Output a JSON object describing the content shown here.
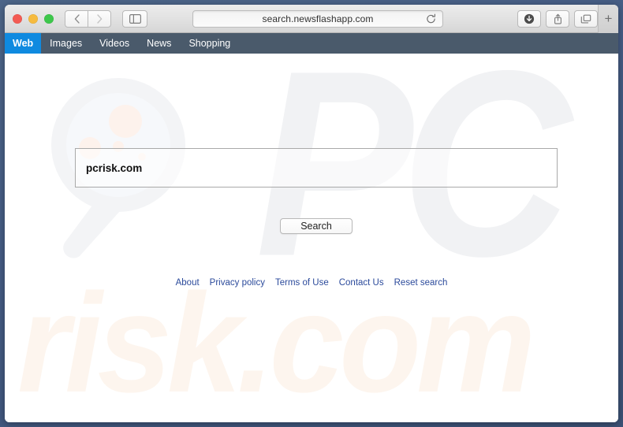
{
  "browser": {
    "traffic_lights": [
      "close",
      "minimize",
      "zoom"
    ],
    "back_label": "‹",
    "forward_label": "›",
    "sidebar_label": "sidebar",
    "url": "search.newsflashapp.com",
    "reload_label": "reload",
    "download_label": "download",
    "share_label": "share",
    "tabs_label": "show-tabs",
    "new_tab_label": "+"
  },
  "site_nav": {
    "items": [
      {
        "label": "Web",
        "active": true
      },
      {
        "label": "Images",
        "active": false
      },
      {
        "label": "Videos",
        "active": false
      },
      {
        "label": "News",
        "active": false
      },
      {
        "label": "Shopping",
        "active": false
      }
    ]
  },
  "search": {
    "query": "pcrisk.com",
    "placeholder": "",
    "button_label": "Search"
  },
  "watermarks": {
    "top": "PC",
    "bottom": "risk.com",
    "magnifier": "magnifying-glass"
  },
  "footer": {
    "links": [
      {
        "label": "About"
      },
      {
        "label": "Privacy policy"
      },
      {
        "label": "Terms of Use"
      },
      {
        "label": "Contact Us"
      },
      {
        "label": "Reset search"
      }
    ]
  },
  "colors": {
    "desktop": "#4b6489",
    "navbar": "#4a5a6b",
    "nav_active": "#0f8ae0",
    "link": "#2b4a9b",
    "watermark_gray": "#f1f2f4",
    "watermark_peach": "#fdf5ee"
  }
}
